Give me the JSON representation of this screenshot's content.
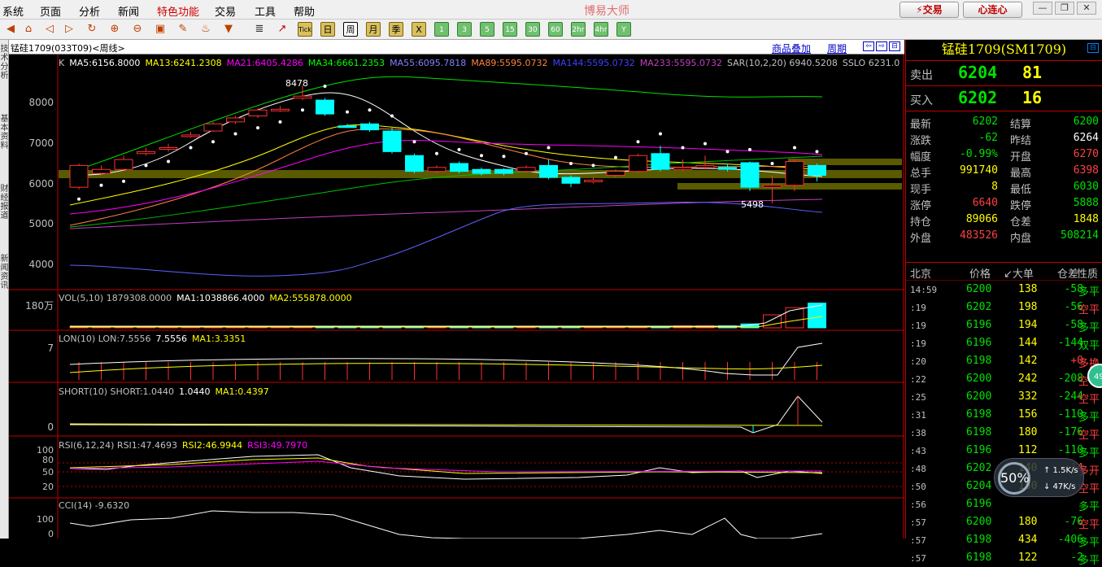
{
  "menu": [
    "系统",
    "页面",
    "分析",
    "新闻",
    "特色功能",
    "交易",
    "工具",
    "帮助"
  ],
  "brand": "博易大师",
  "trade_button": "⚡交易",
  "heart_button": "心连心",
  "window_buttons": [
    "—",
    "❐",
    "✕"
  ],
  "toolbar_periods": [
    "Tick",
    "日",
    "周",
    "月",
    "季",
    "X"
  ],
  "toolbar_minutes": [
    "1",
    "3",
    "5",
    "15",
    "30",
    "60",
    "2hr",
    "4hr",
    "Y"
  ],
  "left_tabs": [
    "技术分析",
    "基本资料",
    "财经报道",
    "新闻资讯"
  ],
  "chart_header": {
    "symbol": "锰硅1709(033T09)<周线>",
    "overlay": "商品叠加",
    "period": "周期"
  },
  "main_legend": [
    {
      "text": "K",
      "color": "#c0c0c0"
    },
    {
      "text": "MA5:6156.8000",
      "color": "#ffffff"
    },
    {
      "text": "MA13:6241.2308",
      "color": "#ffff00"
    },
    {
      "text": "MA21:6405.4286",
      "color": "#ff00ff"
    },
    {
      "text": "MA34:6661.2353",
      "color": "#00ff00"
    },
    {
      "text": "MA55:6095.7818",
      "color": "#8080ff"
    },
    {
      "text": "MA89:5595.0732",
      "color": "#ff8040"
    },
    {
      "text": "MA144:5595.0732",
      "color": "#4040ff"
    },
    {
      "text": "MA233:5595.0732",
      "color": "#c040c0"
    },
    {
      "text": "SAR(10,2,20) 6940.5208",
      "color": "#c0c0c0"
    },
    {
      "text": "SSLO 6231.0",
      "color": "#c0c0c0"
    }
  ],
  "price_axis": [
    "8000",
    "7000",
    "6000",
    "5000",
    "4000"
  ],
  "annotations": {
    "high": "8478",
    "low": "5498"
  },
  "vol_legend": [
    {
      "text": "VOL(5,10) 1879308.0000",
      "color": "#c0c0c0"
    },
    {
      "text": "MA1:1038866.4000",
      "color": "#ffffff"
    },
    {
      "text": "MA2:555878.0000",
      "color": "#ffff00"
    }
  ],
  "vol_axis": "180万",
  "lon_legend": [
    {
      "text": "LON(10) LON:7.5556",
      "color": "#c0c0c0"
    },
    {
      "text": "7.5556",
      "color": "#ffffff"
    },
    {
      "text": "MA1:3.3351",
      "color": "#ffff00"
    }
  ],
  "lon_axis": "7",
  "short_legend": [
    {
      "text": "SHORT(10) SHORT:1.0440",
      "color": "#c0c0c0"
    },
    {
      "text": "1.0440",
      "color": "#ffffff"
    },
    {
      "text": "MA1:0.4397",
      "color": "#ffff00"
    }
  ],
  "short_axis": "0",
  "rsi_legend": [
    {
      "text": "RSI(6,12,24) RSI1:47.4693",
      "color": "#c0c0c0"
    },
    {
      "text": "RSI2:46.9944",
      "color": "#ffff00"
    },
    {
      "text": "RSI3:49.7970",
      "color": "#ff00ff"
    }
  ],
  "rsi_axis": [
    "100",
    "80",
    "50",
    "20"
  ],
  "cci_legend": [
    {
      "text": "CCI(14) -9.6320",
      "color": "#c0c0c0"
    }
  ],
  "cci_axis": [
    "100",
    "0"
  ],
  "right_panel": {
    "title": "锰硅1709(SM1709)",
    "sell": {
      "label": "卖出",
      "price": "6204",
      "vol": "81"
    },
    "buy": {
      "label": "买入",
      "price": "6202",
      "vol": "16"
    },
    "quote": [
      {
        "l1": "最新",
        "v1": "6202",
        "c1": "#00e000",
        "l2": "结算",
        "v2": "6200",
        "c2": "#00e000"
      },
      {
        "l1": "涨跌",
        "v1": "-62",
        "c1": "#00e000",
        "l2": "昨结",
        "v2": "6264",
        "c2": "#ffffff"
      },
      {
        "l1": "幅度",
        "v1": "-0.99%",
        "c1": "#00e000",
        "l2": "开盘",
        "v2": "6270",
        "c2": "#ff4040"
      },
      {
        "l1": "总手",
        "v1": "991740",
        "c1": "#ffff00",
        "l2": "最高",
        "v2": "6398",
        "c2": "#ff4040"
      },
      {
        "l1": "现手",
        "v1": "8",
        "c1": "#ffff00",
        "l2": "最低",
        "v2": "6030",
        "c2": "#00e000"
      },
      {
        "l1": "涨停",
        "v1": "6640",
        "c1": "#ff4040",
        "l2": "跌停",
        "v2": "5888",
        "c2": "#00e000"
      },
      {
        "l1": "持仓",
        "v1": "89066",
        "c1": "#ffff00",
        "l2": "仓差",
        "v2": "1848",
        "c2": "#ffff00"
      },
      {
        "l1": "外盘",
        "v1": "483526",
        "c1": "#ff4040",
        "l2": "内盘",
        "v2": "508214",
        "c2": "#00e000"
      }
    ],
    "ticks_header": [
      "北京",
      "价格",
      "↙大单",
      "仓差",
      "性质"
    ],
    "ticks": [
      {
        "t": "14:59",
        "p": "6200",
        "v": "138",
        "d": "-58",
        "n": "多平",
        "nc": "#00e000"
      },
      {
        "t": ":19",
        "p": "6202",
        "v": "198",
        "d": "-56",
        "n": "空平",
        "nc": "#ff4040"
      },
      {
        "t": ":19",
        "p": "6196",
        "v": "194",
        "d": "-58",
        "n": "多平",
        "nc": "#00e000"
      },
      {
        "t": ":19",
        "p": "6196",
        "v": "144",
        "d": "-144",
        "n": "双平",
        "nc": "#00e000"
      },
      {
        "t": ":20",
        "p": "6198",
        "v": "142",
        "d": "+0",
        "n": "多换",
        "nc": "#ff4040"
      },
      {
        "t": ":22",
        "p": "6200",
        "v": "242",
        "d": "-208",
        "n": "空平",
        "nc": "#ff4040"
      },
      {
        "t": ":25",
        "p": "6200",
        "v": "332",
        "d": "-244",
        "n": "空平",
        "nc": "#ff4040"
      },
      {
        "t": ":31",
        "p": "6198",
        "v": "156",
        "d": "-110",
        "n": "多平",
        "nc": "#00e000"
      },
      {
        "t": ":38",
        "p": "6198",
        "v": "180",
        "d": "-176",
        "n": "空平",
        "nc": "#ff4040"
      },
      {
        "t": ":43",
        "p": "6196",
        "v": "112",
        "d": "-110",
        "n": "多平",
        "nc": "#00e000"
      },
      {
        "t": ":48",
        "p": "6202",
        "v": "140",
        "d": "+14",
        "n": "多开",
        "nc": "#ff4040"
      },
      {
        "t": ":50",
        "p": "6204",
        "v": "150",
        "d": "",
        "n": "空平",
        "nc": "#ff4040"
      },
      {
        "t": ":56",
        "p": "6196",
        "v": "",
        "d": "",
        "n": "多平",
        "nc": "#00e000"
      },
      {
        "t": ":57",
        "p": "6200",
        "v": "180",
        "d": "-76",
        "n": "空平",
        "nc": "#ff4040"
      },
      {
        "t": ":57",
        "p": "6198",
        "v": "434",
        "d": "-406",
        "n": "多平",
        "nc": "#00e000"
      },
      {
        "t": ":57",
        "p": "6198",
        "v": "122",
        "d": "-2",
        "n": "多平",
        "nc": "#00e000"
      }
    ]
  },
  "net_widget": {
    "percent": "50%",
    "up": "↑ 1.5K/s",
    "down": "↓ 47K/s"
  },
  "bubble": "49",
  "colors": {
    "up": "#ff3030",
    "down": "#00ffff",
    "border": "#c00000"
  },
  "chart_data": {
    "type": "candlestick",
    "title": "锰硅1709 周线",
    "y_range": [
      3500,
      8800
    ],
    "candles": [
      {
        "o": 5900,
        "c": 6450,
        "h": 6500,
        "l": 5850
      },
      {
        "o": 6250,
        "c": 6350,
        "h": 6450,
        "l": 6200
      },
      {
        "o": 6350,
        "c": 6600,
        "h": 6700,
        "l": 6300
      },
      {
        "o": 6750,
        "c": 6800,
        "h": 6900,
        "l": 6700
      },
      {
        "o": 6880,
        "c": 6900,
        "h": 7000,
        "l": 6800
      },
      {
        "o": 7200,
        "c": 7220,
        "h": 7300,
        "l": 7150
      },
      {
        "o": 7320,
        "c": 7500,
        "h": 7550,
        "l": 7300
      },
      {
        "o": 7550,
        "c": 7650,
        "h": 7700,
        "l": 7500
      },
      {
        "o": 7700,
        "c": 7850,
        "h": 7900,
        "l": 7650
      },
      {
        "o": 7850,
        "c": 7870,
        "h": 7950,
        "l": 7800
      },
      {
        "o": 8150,
        "c": 8200,
        "h": 8478,
        "l": 8100
      },
      {
        "o": 8100,
        "c": 7750,
        "h": 8150,
        "l": 7700
      },
      {
        "o": 7450,
        "c": 7420,
        "h": 7500,
        "l": 7400
      },
      {
        "o": 7500,
        "c": 7350,
        "h": 7550,
        "l": 7300
      },
      {
        "o": 7320,
        "c": 6800,
        "h": 7400,
        "l": 6750
      },
      {
        "o": 6700,
        "c": 6300,
        "h": 6750,
        "l": 6250
      },
      {
        "o": 6300,
        "c": 6400,
        "h": 6450,
        "l": 6250
      },
      {
        "o": 6500,
        "c": 6300,
        "h": 6550,
        "l": 6250
      },
      {
        "o": 6350,
        "c": 6250,
        "h": 6400,
        "l": 6200
      },
      {
        "o": 6350,
        "c": 6250,
        "h": 6380,
        "l": 6200
      },
      {
        "o": 6300,
        "c": 6400,
        "h": 6450,
        "l": 6250
      },
      {
        "o": 6450,
        "c": 6150,
        "h": 6600,
        "l": 6100
      },
      {
        "o": 6150,
        "c": 6000,
        "h": 6200,
        "l": 5900
      },
      {
        "o": 6050,
        "c": 6080,
        "h": 6150,
        "l": 6000
      },
      {
        "o": 6200,
        "c": 6300,
        "h": 6350,
        "l": 6150
      },
      {
        "o": 6300,
        "c": 6700,
        "h": 6750,
        "l": 6250
      },
      {
        "o": 6750,
        "c": 6350,
        "h": 6950,
        "l": 6300
      },
      {
        "o": 6350,
        "c": 6400,
        "h": 6600,
        "l": 6300
      },
      {
        "o": 6400,
        "c": 6450,
        "h": 6700,
        "l": 6350
      },
      {
        "o": 6400,
        "c": 6350,
        "h": 6500,
        "l": 6300
      },
      {
        "o": 6520,
        "c": 5900,
        "h": 6550,
        "l": 5800
      },
      {
        "o": 5900,
        "c": 5950,
        "h": 6200,
        "l": 5498
      },
      {
        "o": 5950,
        "c": 6550,
        "h": 6600,
        "l": 5800
      },
      {
        "o": 6450,
        "c": 6200,
        "h": 6500,
        "l": 6050
      }
    ],
    "volume": [
      40,
      40,
      40,
      40,
      40,
      40,
      40,
      40,
      40,
      40,
      40,
      40,
      40,
      40,
      40,
      40,
      40,
      40,
      40,
      40,
      40,
      40,
      40,
      40,
      40,
      40,
      40,
      60,
      60,
      60,
      120,
      400,
      620,
      760
    ],
    "vol_max": 800
  }
}
